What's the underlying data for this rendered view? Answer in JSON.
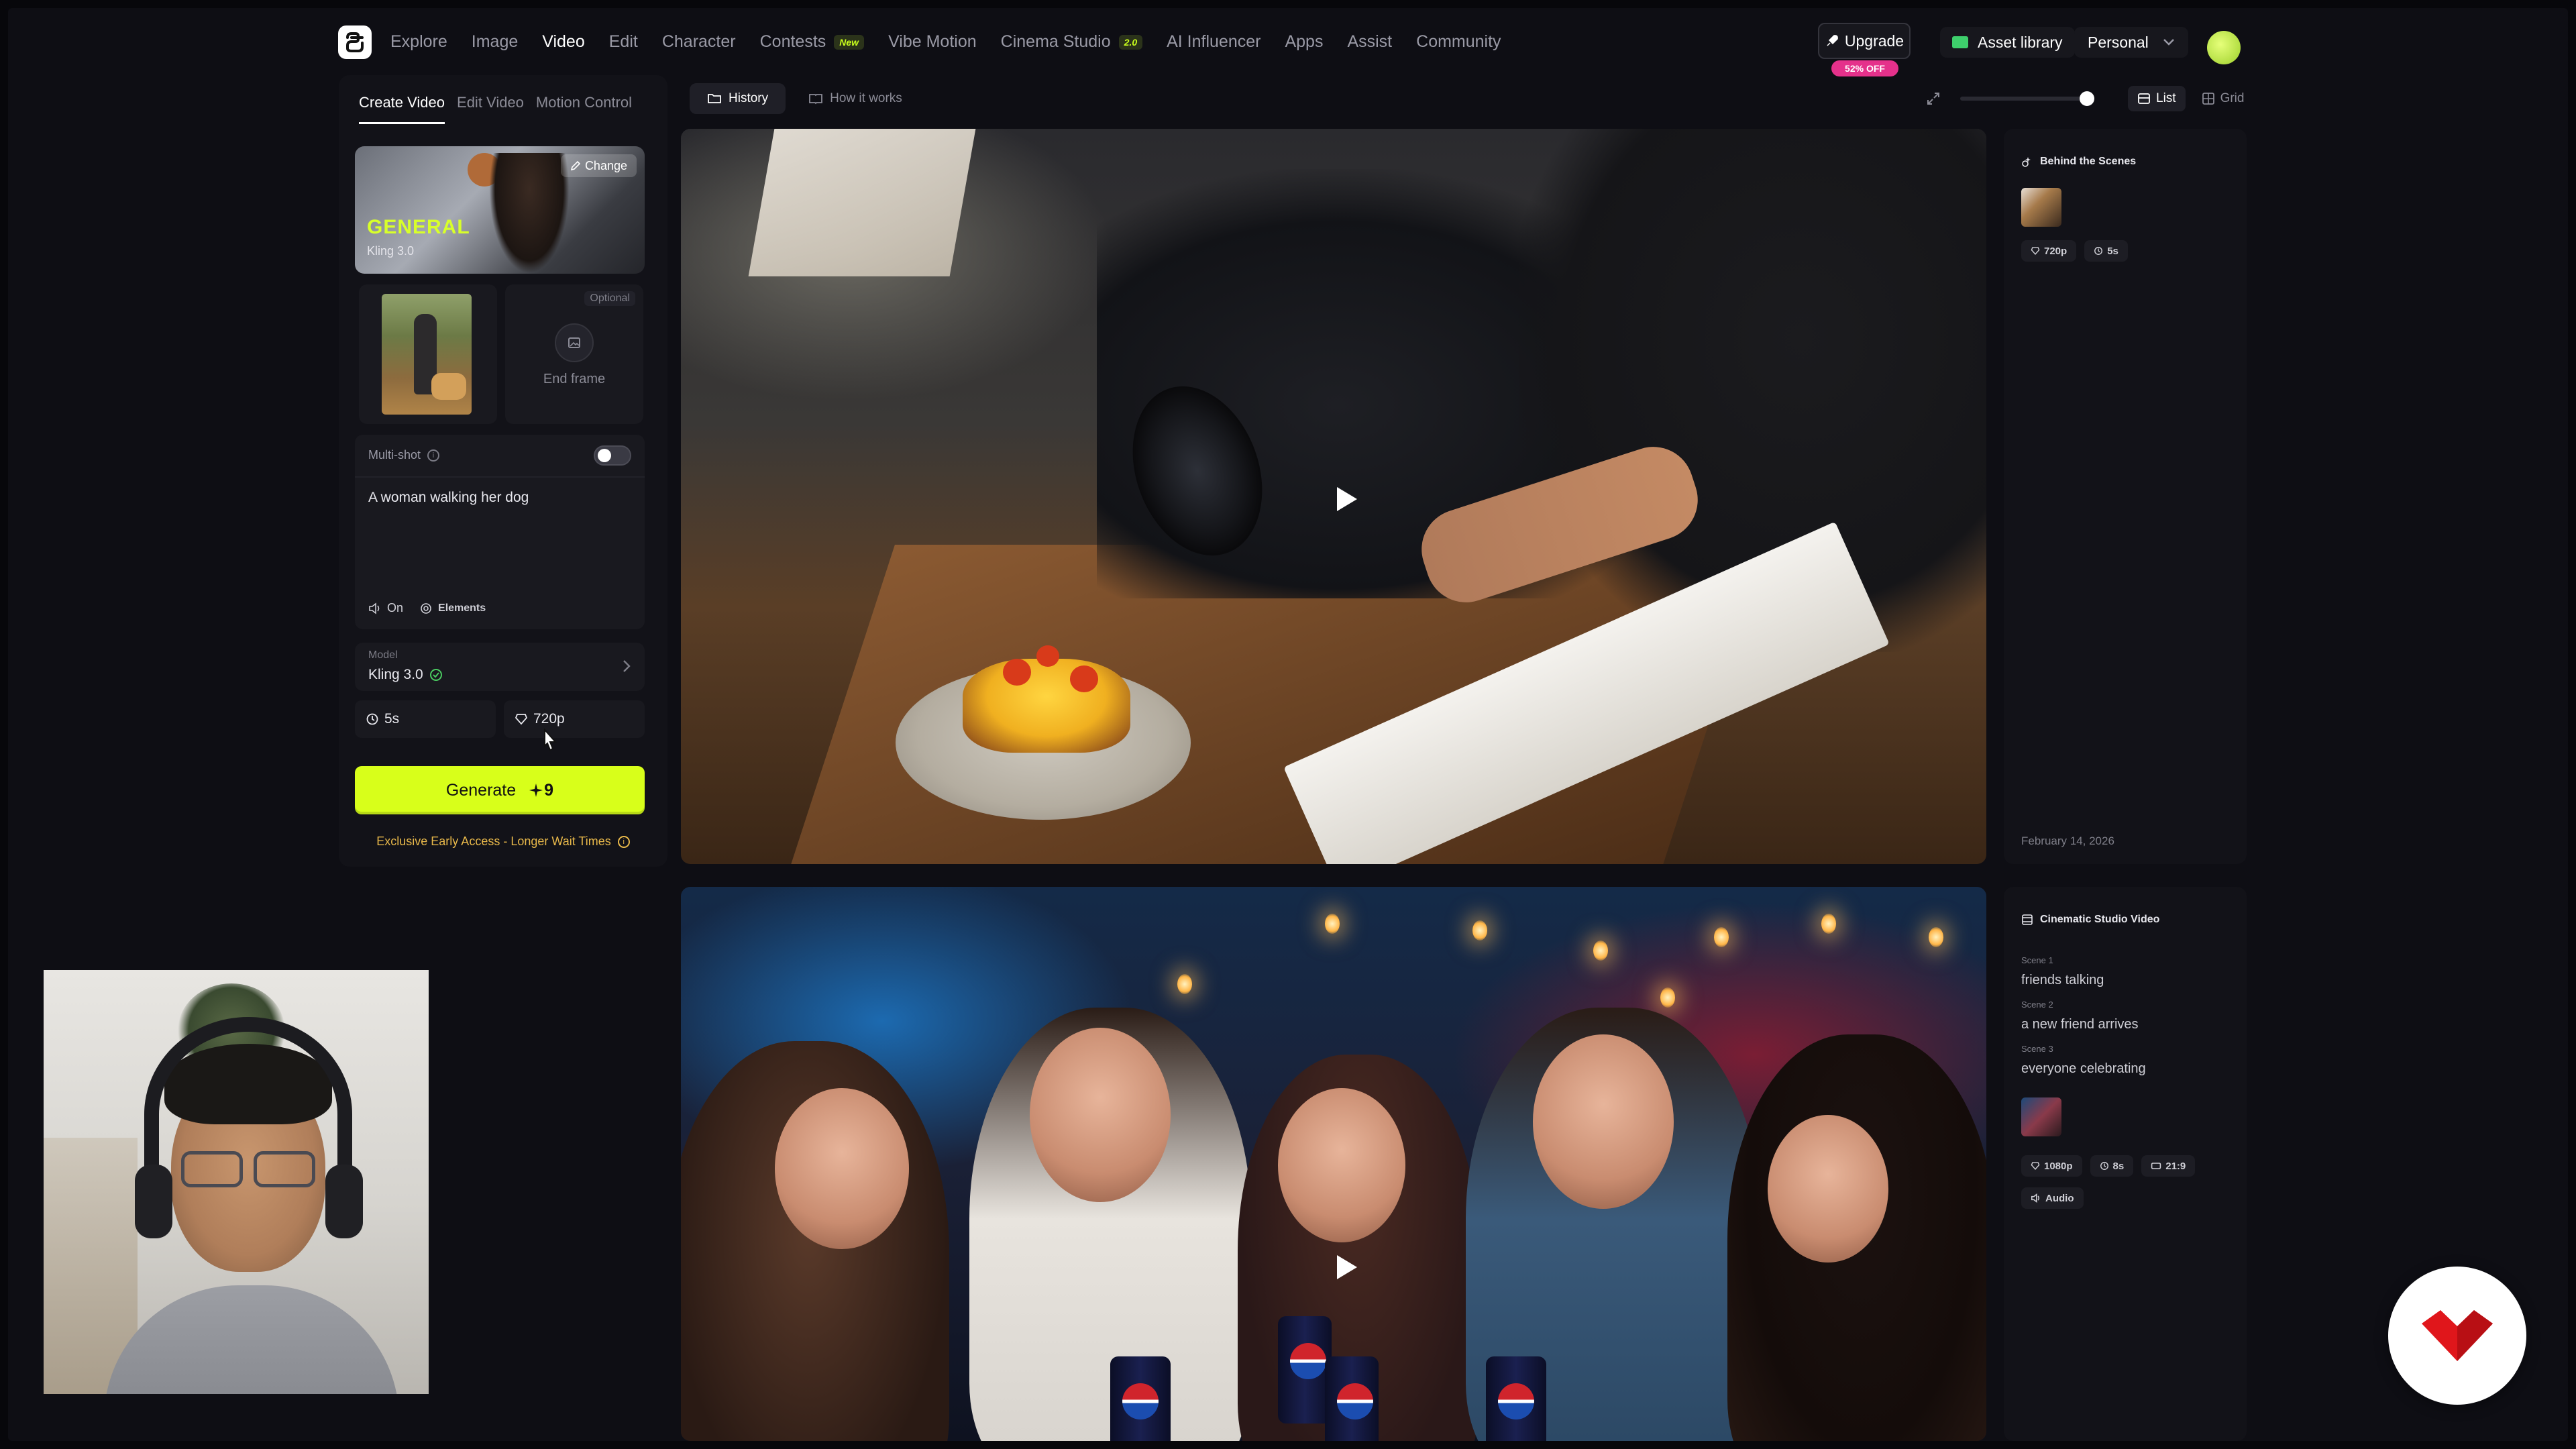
{
  "nav": {
    "items": [
      {
        "label": "Explore",
        "active": false,
        "badge": ""
      },
      {
        "label": "Image",
        "active": false,
        "badge": ""
      },
      {
        "label": "Video",
        "active": true,
        "badge": ""
      },
      {
        "label": "Edit",
        "active": false,
        "badge": ""
      },
      {
        "label": "Character",
        "active": false,
        "badge": ""
      },
      {
        "label": "Contests",
        "active": false,
        "badge": "New"
      },
      {
        "label": "Vibe Motion",
        "active": false,
        "badge": ""
      },
      {
        "label": "Cinema Studio",
        "active": false,
        "badge": "2.0"
      },
      {
        "label": "AI Influencer",
        "active": false,
        "badge": ""
      },
      {
        "label": "Apps",
        "active": false,
        "badge": ""
      },
      {
        "label": "Assist",
        "active": false,
        "badge": ""
      },
      {
        "label": "Community",
        "active": false,
        "badge": ""
      }
    ],
    "upgrade_label": "Upgrade",
    "discount_label": "52% OFF",
    "asset_library_label": "Asset library",
    "workspace_label": "Personal"
  },
  "left_panel": {
    "tabs": [
      {
        "label": "Create Video",
        "active": true
      },
      {
        "label": "Edit Video",
        "active": false
      },
      {
        "label": "Motion Control",
        "active": false
      }
    ],
    "preset": {
      "title": "GENERAL",
      "subtitle": "Kling 3.0",
      "change_label": "Change"
    },
    "frames": {
      "optional_label": "Optional",
      "end_frame_label": "End frame"
    },
    "multishot_label": "Multi-shot",
    "multishot_enabled": false,
    "prompt_text": "A woman walking her dog",
    "audio_label": "On",
    "elements_label": "Elements",
    "model": {
      "label": "Model",
      "value": "Kling 3.0"
    },
    "duration": "5s",
    "resolution": "720p",
    "generate_label": "Generate",
    "generate_credits": "9",
    "early_access_label": "Exclusive Early Access - Longer Wait Times"
  },
  "view": {
    "tabs": [
      {
        "label": "History",
        "active": true
      },
      {
        "label": "How it works",
        "active": false
      }
    ],
    "list_label": "List",
    "grid_label": "Grid",
    "zoom_level": 1.0
  },
  "cards": [
    {
      "title": "Behind the Scenes",
      "chips": [
        "720p",
        "5s"
      ],
      "date": "February 14, 2026"
    },
    {
      "title": "Cinematic Studio Video",
      "scenes": [
        {
          "label": "Scene 1",
          "text": "friends talking"
        },
        {
          "label": "Scene 2",
          "text": "a new friend arrives"
        },
        {
          "label": "Scene 3",
          "text": "everyone celebrating"
        }
      ],
      "chips": [
        "1080p",
        "8s",
        "21:9"
      ],
      "audio_chip": "Audio"
    }
  ],
  "colors": {
    "accent": "#d8ff1a",
    "discount": "#e5318b",
    "brand_badge": "#e0161b",
    "warning_text": "#e8b84a"
  }
}
